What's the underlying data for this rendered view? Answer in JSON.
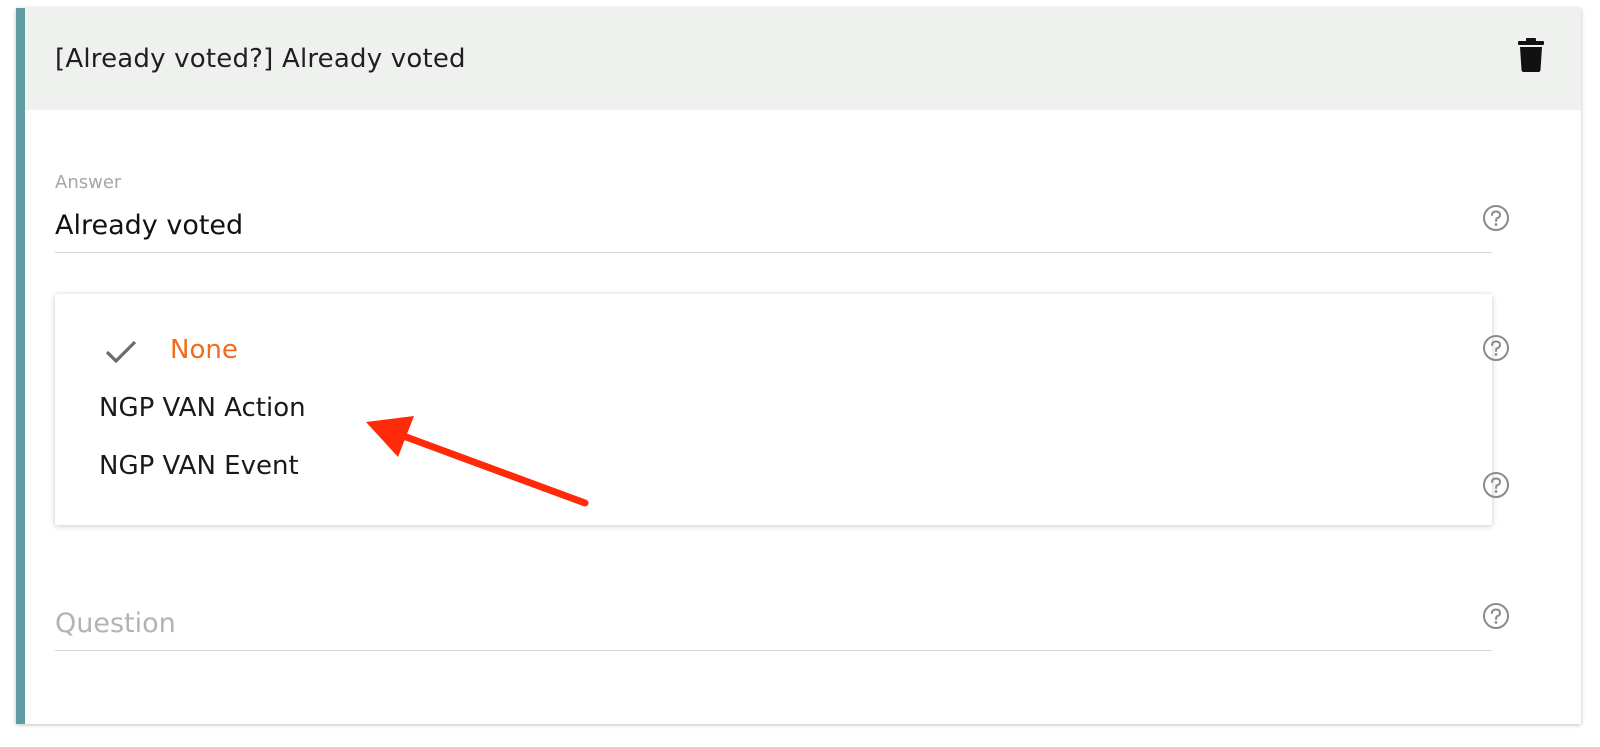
{
  "card": {
    "title": "[Already voted?] Already voted",
    "accent_color": "#5e9ba2",
    "delete_icon": "trash-icon"
  },
  "answer_field": {
    "label": "Answer",
    "value": "Already voted",
    "help_icon": "help-circle-icon"
  },
  "action_dropdown": {
    "options": [
      {
        "label": "None",
        "selected": true
      },
      {
        "label": "NGP VAN Action",
        "selected": false
      },
      {
        "label": "NGP VAN Event",
        "selected": false
      }
    ],
    "selected_color": "#f26a1b",
    "check_icon": "checkmark-icon"
  },
  "question_field": {
    "placeholder": "Question",
    "help_icon": "help-circle-icon"
  },
  "annotation": {
    "arrow_color": "#ff2a0a",
    "arrow_icon": "red-arrow-annotation"
  }
}
